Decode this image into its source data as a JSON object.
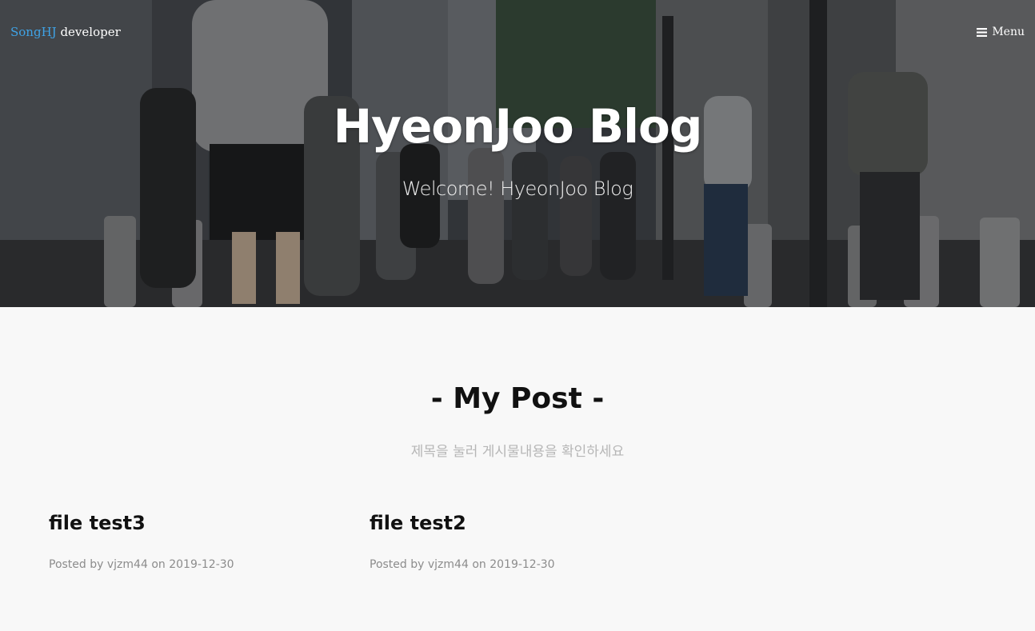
{
  "nav": {
    "brand_accent": "SongHJ",
    "brand_rest": " developer",
    "menu_label": "Menu"
  },
  "hero": {
    "title": "HyeonJoo Blog",
    "subtitle": "Welcome! HyeonJoo Blog"
  },
  "section": {
    "title": "- My Post -",
    "subtitle": "제목을 눌러 게시물내용을 확인하세요"
  },
  "posts": [
    {
      "title": "file test3",
      "posted_by_prefix": "Posted by",
      "author": "vjzm44",
      "on_word": "on",
      "date": "2019-12-30"
    },
    {
      "title": "file test2",
      "posted_by_prefix": "Posted by",
      "author": "vjzm44",
      "on_word": "on",
      "date": "2019-12-30"
    }
  ],
  "colors": {
    "brand_accent": "#3fa3e6",
    "page_bg": "#f8f8f8",
    "meta_text": "#8c8c8c",
    "subtitle_text": "#b6b6b6"
  },
  "icons": {
    "menu": "bars-icon"
  }
}
